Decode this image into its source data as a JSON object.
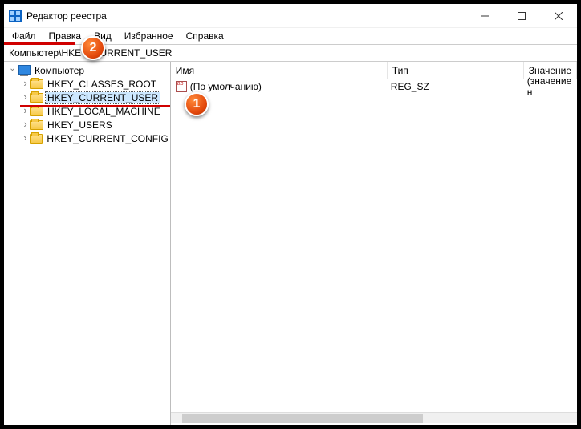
{
  "window": {
    "title": "Редактор реестра"
  },
  "menu": {
    "file": "Файл",
    "edit": "Правка",
    "view": "Вид",
    "favorites": "Избранное",
    "help": "Справка"
  },
  "address": "Компьютер\\HKEY_CURRENT_USER",
  "tree": {
    "root": "Компьютер",
    "items": [
      "HKEY_CLASSES_ROOT",
      "HKEY_CURRENT_USER",
      "HKEY_LOCAL_MACHINE",
      "HKEY_USERS",
      "HKEY_CURRENT_CONFIG"
    ]
  },
  "list": {
    "headers": {
      "name": "Имя",
      "type": "Тип",
      "value": "Значение"
    },
    "row": {
      "name": "(По умолчанию)",
      "type": "REG_SZ",
      "value": "(значение н"
    }
  },
  "badges": {
    "one": "1",
    "two": "2"
  }
}
